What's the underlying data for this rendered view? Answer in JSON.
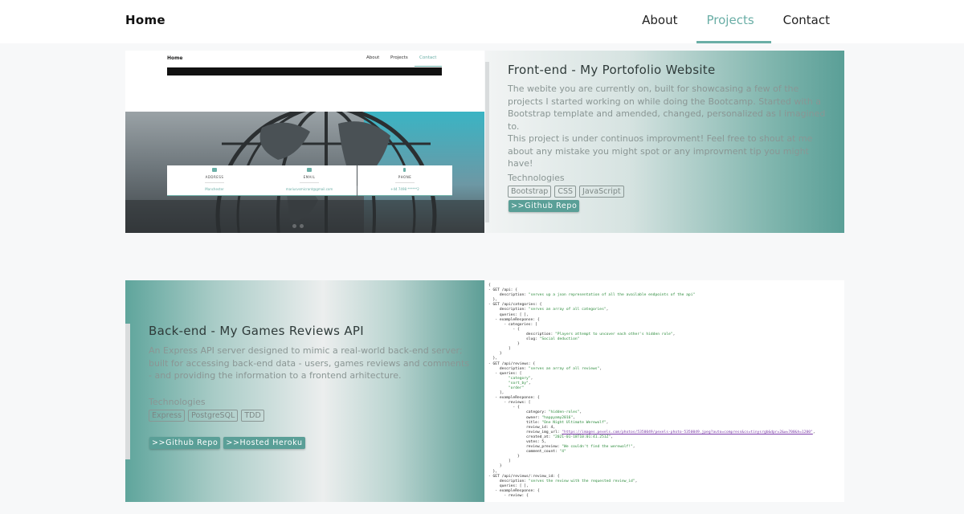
{
  "navbar": {
    "brand": "Home",
    "links": [
      "About",
      "Projects",
      "Contact"
    ],
    "active": "Projects"
  },
  "projects": [
    {
      "title": "Front-end - My Portofolio Website",
      "description": "The webite you are currently on, built for showcasing a few of the projects I started working on while doing the Bootcamp. Started with a Bootstrap template and amended, changed, personalized as I imagined to.",
      "description2": "This project is under continuos improvment! Feel free to shout at me about any mistake you might spot or any improvment tip you might have!",
      "tech_label": "Technologies",
      "tags": [
        "Bootstrap",
        "CSS",
        "JavaScript"
      ],
      "buttons": [
        ">>Github Repo"
      ],
      "preview": {
        "nav_home": "Home",
        "nav_links": [
          "About",
          "Projects",
          "Contact"
        ],
        "cards": [
          {
            "title": "ADDRESS",
            "value": "Manchester"
          },
          {
            "title": "EMAIL",
            "value": "mariusvsmicrant@gmail.com"
          },
          {
            "title": "PHONE",
            "value": "+44 7498 ******2"
          }
        ]
      }
    },
    {
      "title": "Back-end - My Games Reviews API",
      "description": "An Express API server designed to mimic a real-world back-end server; built for accessing back-end data - users, games reviews and comments - and providing the information to a frontend arhitecture.",
      "tech_label": "Technologies",
      "tags": [
        "Express",
        "PostgreSQL",
        "TDD"
      ],
      "buttons": [
        ">>Github Repo",
        ">>Hosted Heroku"
      ]
    }
  ],
  "colors": {
    "accent": "#6aaea6",
    "button": "#5a9f97",
    "page_bg": "#f7f8f9"
  }
}
